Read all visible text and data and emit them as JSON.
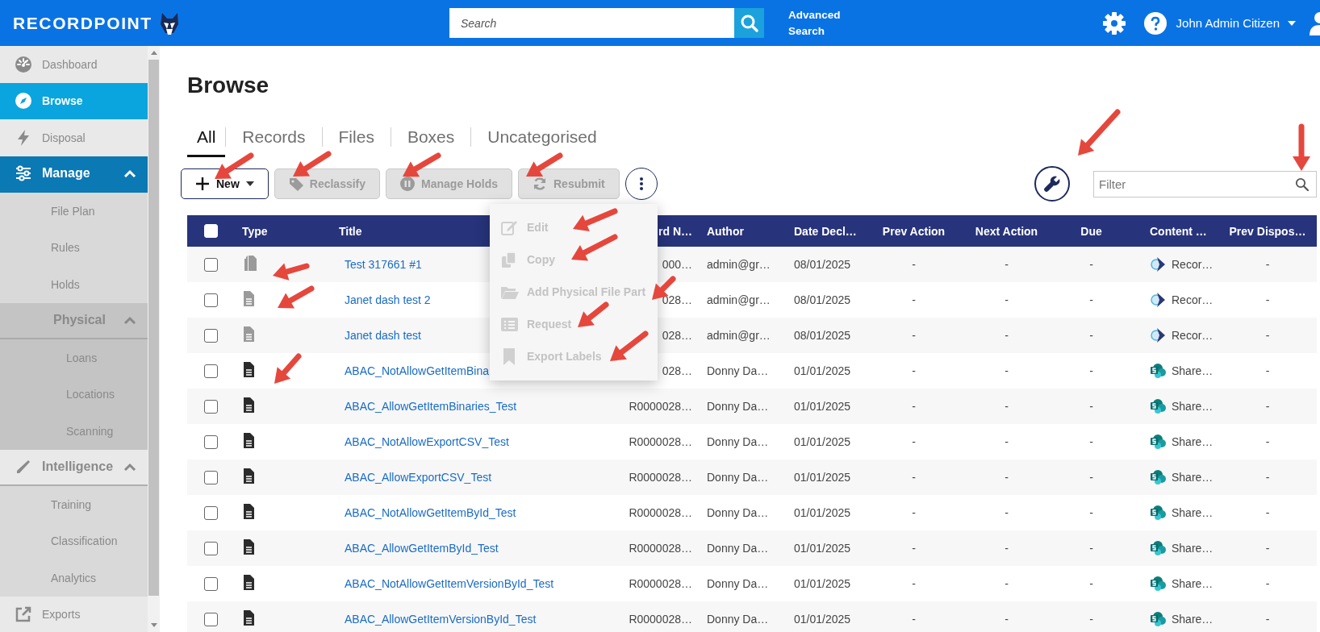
{
  "header": {
    "logo": "RECORDPOINT",
    "search": {
      "placeholder": "Search"
    },
    "advanced_search": "Advanced Search",
    "user": "John Admin Citizen"
  },
  "sidebar": {
    "items": [
      {
        "label": "Dashboard",
        "selected": false,
        "hovered": false
      },
      {
        "label": "Browse",
        "selected": true,
        "hovered": false
      },
      {
        "label": "Disposal",
        "selected": false,
        "hovered": false
      },
      {
        "label": "Manage",
        "selected": false,
        "hovered": true,
        "expanded": true,
        "children": [
          {
            "label": "File Plan",
            "selected": false,
            "hovered": false
          },
          {
            "label": "Rules",
            "selected": false,
            "hovered": false
          },
          {
            "label": "Holds",
            "selected": false,
            "hovered": false
          },
          {
            "label": "Physical",
            "selected": false,
            "hovered": false,
            "expanded": true,
            "children": [
              {
                "label": "Loans",
                "selected": false,
                "hovered": false
              },
              {
                "label": "Locations",
                "selected": false,
                "hovered": false
              },
              {
                "label": "Scanning",
                "selected": false,
                "hovered": false
              }
            ]
          }
        ]
      },
      {
        "label": "Intelligence",
        "selected": false,
        "hovered": false,
        "expanded": true,
        "children": [
          {
            "label": "Training",
            "selected": false,
            "hovered": false
          },
          {
            "label": "Classification",
            "selected": false,
            "hovered": false
          },
          {
            "label": "Analytics",
            "selected": false,
            "hovered": false
          }
        ]
      },
      {
        "label": "Exports",
        "selected": false,
        "hovered": false
      }
    ]
  },
  "page": {
    "title": "Browse"
  },
  "tabs": [
    {
      "label": "All",
      "selected": true
    },
    {
      "label": "Records",
      "selected": false
    },
    {
      "label": "Files",
      "selected": false
    },
    {
      "label": "Boxes",
      "selected": false
    },
    {
      "label": "Uncategorised",
      "selected": false
    }
  ],
  "toolbar": {
    "buttons": [
      {
        "label": "New",
        "kind": "new",
        "disabled": false
      },
      {
        "label": "Reclassify",
        "kind": "tag",
        "disabled": true
      },
      {
        "label": "Manage Holds",
        "kind": "pause",
        "disabled": true
      },
      {
        "label": "Resubmit",
        "kind": "refresh",
        "disabled": true
      }
    ],
    "filter": {
      "placeholder": "Filter"
    }
  },
  "menu": {
    "items": [
      {
        "label": "Edit",
        "disabled": true
      },
      {
        "label": "Copy",
        "disabled": true
      },
      {
        "label": "Add Physical File Part",
        "disabled": true
      },
      {
        "label": "Request",
        "disabled": true
      },
      {
        "label": "Export Labels",
        "disabled": true
      }
    ]
  },
  "table": {
    "select_all": {
      "checked": false
    },
    "columns": [
      "Type",
      "Title",
      "rd N…",
      "Author",
      "Date Decl…",
      "Prev Action",
      "Next Action",
      "Due",
      "Content …",
      "Prev Dispos…"
    ],
    "rows": [
      {
        "checked": false,
        "kind": "multi",
        "dimmed": true,
        "title": "Test 317661 #1",
        "record_number": "000…",
        "author": "admin@gr…",
        "date_declared": "08/01/2025",
        "prev_action": "-",
        "next_action": "-",
        "due": "-",
        "content": {
          "kind": "records",
          "label": "Recor…"
        },
        "prev_disposal": "-"
      },
      {
        "checked": false,
        "kind": "document",
        "dimmed": true,
        "title": "Janet dash test 2",
        "record_number": "028…",
        "author": "admin@gr…",
        "date_declared": "08/01/2025",
        "prev_action": "-",
        "next_action": "-",
        "due": "-",
        "content": {
          "kind": "records",
          "label": "Recor…"
        },
        "prev_disposal": "-"
      },
      {
        "checked": false,
        "kind": "document",
        "dimmed": true,
        "title": "Janet dash test",
        "record_number": "028…",
        "author": "admin@gr…",
        "date_declared": "08/01/2025",
        "prev_action": "-",
        "next_action": "-",
        "due": "-",
        "content": {
          "kind": "records",
          "label": "Recor…"
        },
        "prev_disposal": "-"
      },
      {
        "checked": false,
        "kind": "document",
        "dimmed": false,
        "title": "ABAC_NotAllowGetItemBina",
        "record_number": "028…",
        "author": "Donny Da…",
        "date_declared": "01/01/2025",
        "prev_action": "-",
        "next_action": "-",
        "due": "-",
        "content": {
          "kind": "sharepoint",
          "label": "Share…"
        },
        "prev_disposal": "-"
      },
      {
        "checked": false,
        "kind": "document",
        "dimmed": false,
        "title": "ABAC_AllowGetItemBinaries_Test",
        "record_number": "R0000028…",
        "author": "Donny Da…",
        "date_declared": "01/01/2025",
        "prev_action": "-",
        "next_action": "-",
        "due": "-",
        "content": {
          "kind": "sharepoint",
          "label": "Share…"
        },
        "prev_disposal": "-"
      },
      {
        "checked": false,
        "kind": "document",
        "dimmed": false,
        "title": "ABAC_NotAllowExportCSV_Test",
        "record_number": "R0000028…",
        "author": "Donny Da…",
        "date_declared": "01/01/2025",
        "prev_action": "-",
        "next_action": "-",
        "due": "-",
        "content": {
          "kind": "sharepoint",
          "label": "Share…"
        },
        "prev_disposal": "-"
      },
      {
        "checked": false,
        "kind": "document",
        "dimmed": false,
        "title": "ABAC_AllowExportCSV_Test",
        "record_number": "R0000028…",
        "author": "Donny Da…",
        "date_declared": "01/01/2025",
        "prev_action": "-",
        "next_action": "-",
        "due": "-",
        "content": {
          "kind": "sharepoint",
          "label": "Share…"
        },
        "prev_disposal": "-"
      },
      {
        "checked": false,
        "kind": "document",
        "dimmed": false,
        "title": "ABAC_NotAllowGetItemById_Test",
        "record_number": "R0000028…",
        "author": "Donny Da…",
        "date_declared": "01/01/2025",
        "prev_action": "-",
        "next_action": "-",
        "due": "-",
        "content": {
          "kind": "sharepoint",
          "label": "Share…"
        },
        "prev_disposal": "-"
      },
      {
        "checked": false,
        "kind": "document",
        "dimmed": false,
        "title": "ABAC_AllowGetItemById_Test",
        "record_number": "R0000028…",
        "author": "Donny Da…",
        "date_declared": "01/01/2025",
        "prev_action": "-",
        "next_action": "-",
        "due": "-",
        "content": {
          "kind": "sharepoint",
          "label": "Share…"
        },
        "prev_disposal": "-"
      },
      {
        "checked": false,
        "kind": "document",
        "dimmed": false,
        "title": "ABAC_NotAllowGetItemVersionById_Test",
        "record_number": "R0000028…",
        "author": "Donny Da…",
        "date_declared": "01/01/2025",
        "prev_action": "-",
        "next_action": "-",
        "due": "-",
        "content": {
          "kind": "sharepoint",
          "label": "Share…"
        },
        "prev_disposal": "-"
      },
      {
        "checked": false,
        "kind": "document",
        "dimmed": false,
        "title": "ABAC_AllowGetItemVersionById_Test",
        "record_number": "R0000028…",
        "author": "Donny Da…",
        "date_declared": "01/01/2025",
        "prev_action": "-",
        "next_action": "-",
        "due": "-",
        "content": {
          "kind": "sharepoint",
          "label": "Share…"
        },
        "prev_disposal": "-"
      }
    ]
  }
}
